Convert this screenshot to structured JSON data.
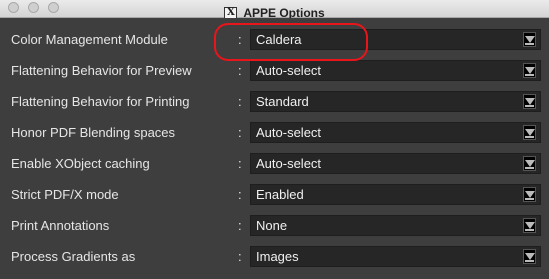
{
  "window": {
    "title": "APPE Options",
    "app_icon": "x11-icon"
  },
  "options": [
    {
      "label": "Color Management Module",
      "value": "Caldera"
    },
    {
      "label": "Flattening Behavior for Preview",
      "value": "Auto-select"
    },
    {
      "label": "Flattening Behavior for Printing",
      "value": "Standard"
    },
    {
      "label": "Honor PDF Blending spaces",
      "value": "Auto-select"
    },
    {
      "label": "Enable XObject caching",
      "value": "Auto-select"
    },
    {
      "label": "Strict PDF/X mode",
      "value": "Enabled"
    },
    {
      "label": "Print Annotations",
      "value": "None"
    },
    {
      "label": "Process Gradients as",
      "value": "Images"
    }
  ],
  "separator": ":",
  "colors": {
    "annotation_highlight": "#e8151b",
    "background": "#3e3e3e",
    "select_bg": "#262626"
  }
}
